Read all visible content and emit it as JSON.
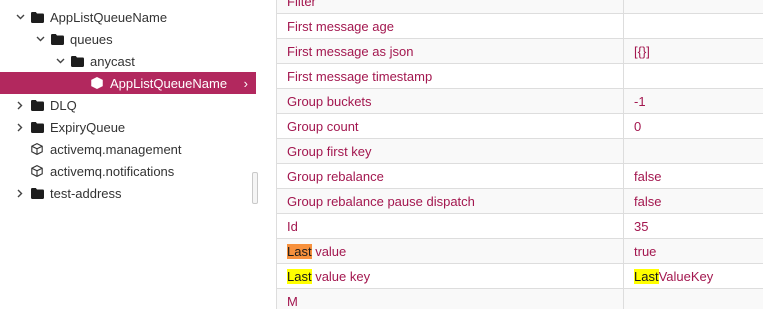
{
  "tree": {
    "rows": [
      {
        "label": "AppListQueueName",
        "twisty": "open",
        "icon": "folder-icon",
        "depth": 1
      },
      {
        "label": "queues",
        "twisty": "open",
        "icon": "folder-icon",
        "depth": 2
      },
      {
        "label": "anycast",
        "twisty": "open",
        "icon": "folder-icon",
        "depth": 3
      },
      {
        "label": "AppListQueueName",
        "twisty": "",
        "icon": "cube-icon",
        "depth": 4,
        "selected": true
      },
      {
        "label": "DLQ",
        "twisty": "closed",
        "icon": "folder-icon",
        "depth": 1
      },
      {
        "label": "ExpiryQueue",
        "twisty": "closed",
        "icon": "folder-icon",
        "depth": 1
      },
      {
        "label": "activemq.management",
        "twisty": "",
        "icon": "cube-icon",
        "depth": 1
      },
      {
        "label": "activemq.notifications",
        "twisty": "",
        "icon": "cube-icon",
        "depth": 1
      },
      {
        "label": "test-address",
        "twisty": "closed",
        "icon": "folder-icon",
        "depth": 1
      }
    ],
    "selected_arrow": "›"
  },
  "attributes": {
    "rows": [
      {
        "key": "Filter",
        "value": ""
      },
      {
        "key": "First message age",
        "value": ""
      },
      {
        "key": "First message as json",
        "value": "[{}]"
      },
      {
        "key": "First message timestamp",
        "value": ""
      },
      {
        "key": "Group buckets",
        "value": "-1"
      },
      {
        "key": "Group count",
        "value": "0"
      },
      {
        "key": "Group first key",
        "value": ""
      },
      {
        "key": "Group rebalance",
        "value": "false"
      },
      {
        "key": "Group rebalance pause dispatch",
        "value": "false"
      },
      {
        "key": "Id",
        "value": "35"
      },
      {
        "key_hl": "Last",
        "key_hl_color": "orange",
        "key_rest": " value",
        "value": "true"
      },
      {
        "key_hl": "Last",
        "key_hl_color": "yellow",
        "key_rest": " value key",
        "value_hl": "Last",
        "value_rest": "ValueKey"
      },
      {
        "key": "M",
        "value": ""
      }
    ]
  },
  "colors": {
    "accent": "#b2285e",
    "text": "#a3174f",
    "highlight_orange": "#f7913d",
    "highlight_yellow": "#ffff00"
  }
}
